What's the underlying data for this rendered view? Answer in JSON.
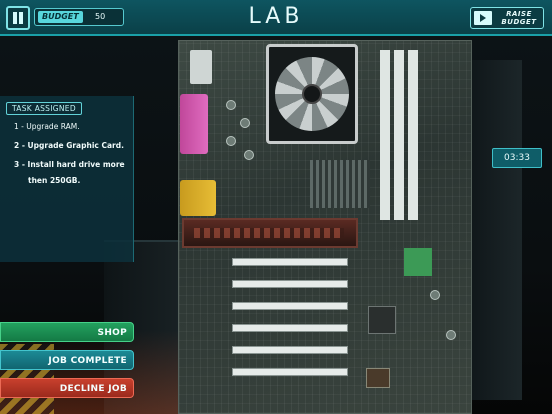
{
  "header": {
    "title": "LAB",
    "budget_label": "BUDGET",
    "budget_value": "50",
    "raise_budget_label": "RAISE BUDGET"
  },
  "task_panel": {
    "header": "TASK ASSIGNED",
    "items": [
      "1 - Upgrade RAM.",
      "2 - Upgrade Graphic Card.",
      "3 - Install hard drive more",
      "then 250GB."
    ]
  },
  "timer": "03:33",
  "actions": {
    "shop": "SHOP",
    "job_complete": "JOB COMPLETE",
    "decline_job": "DECLINE JOB"
  },
  "icons": {
    "pause": "pause-icon",
    "raise_budget": "video-play-icon"
  },
  "colors": {
    "topbar": "#0e5560",
    "accent": "#1aa0a8",
    "shop": "#23a15f",
    "job_complete": "#1c8a95",
    "decline": "#c8402d"
  }
}
